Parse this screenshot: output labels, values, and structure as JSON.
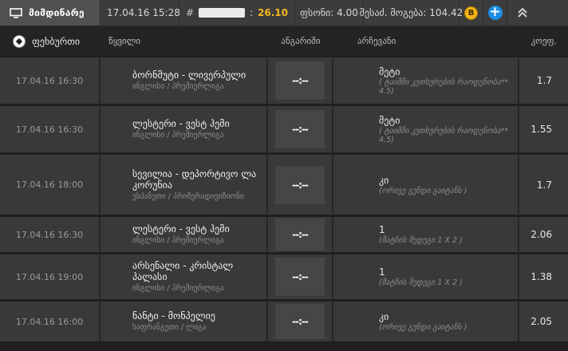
{
  "topbar": {
    "current_label": "მიმდინარე",
    "datetime": "17.04.16 15:28",
    "id_hash": "#",
    "id_sep": ":",
    "total_coef": "26.10",
    "stake_label": "ფსონი:",
    "stake_value": "4.00",
    "possible_win_label": "შესაძ. მოგება:",
    "possible_win_value": "104.42",
    "coin_letter": "B"
  },
  "header": {
    "sport": "ფეხბურთი",
    "pair": "წყვილი",
    "account": "ანგარიში",
    "outcome": "არჩევანი",
    "odds": "კოეფ."
  },
  "rows": [
    {
      "date": "17.04.16 16:30",
      "team": "ბორნმუტი - ლივერპული",
      "league": "ინგლისი / პრემიერლიგა",
      "score": "--:--",
      "outcome": "მეტი",
      "outcome_sub": "( ტაიმში კუთხურების რაოდენობა** 4.5)",
      "odds": "1.7"
    },
    {
      "date": "17.04.16 16:30",
      "team": "ლესტერი - ვესტ ჰემი",
      "league": "ინგლისი / პრემიერლიგა",
      "score": "--:--",
      "outcome": "მეტი",
      "outcome_sub": "( ტაიმში კუთხურების რაოდენობა** 4.5)",
      "odds": "1.55"
    },
    {
      "date": "17.04.16 18:00",
      "team": "სევილია - დეპორტივო ლა კორუნია",
      "league": "ესპანეთი / პრიმერადივიზიონი",
      "score": "--:--",
      "outcome": "კი",
      "outcome_sub": "(ორივე გუნდი გაიტანს )",
      "odds": "1.7"
    },
    {
      "date": "17.04.16 16:30",
      "team": "ლესტერი - ვესტ ჰემი",
      "league": "ინგლისი / პრემიერლიგა",
      "score": "--:--",
      "outcome": "1",
      "outcome_sub": "(მატჩის შედეგი 1 X 2 )",
      "odds": "2.06"
    },
    {
      "date": "17.04.16 19:00",
      "team": "არსენალი - კრისტალ პალასი",
      "league": "ინგლისი / პრემიერლიგა",
      "score": "--:--",
      "outcome": "1",
      "outcome_sub": "(მატჩის შედეგი 1 X 2 )",
      "odds": "1.38"
    },
    {
      "date": "17.04.16 16:00",
      "team": "ნანტი - მონპელიე",
      "league": "საფრანგეთი / ლიგა",
      "score": "--:--",
      "outcome": "კი",
      "outcome_sub": "(ორივე გუნდი გაიტანს )",
      "odds": "2.05"
    }
  ]
}
